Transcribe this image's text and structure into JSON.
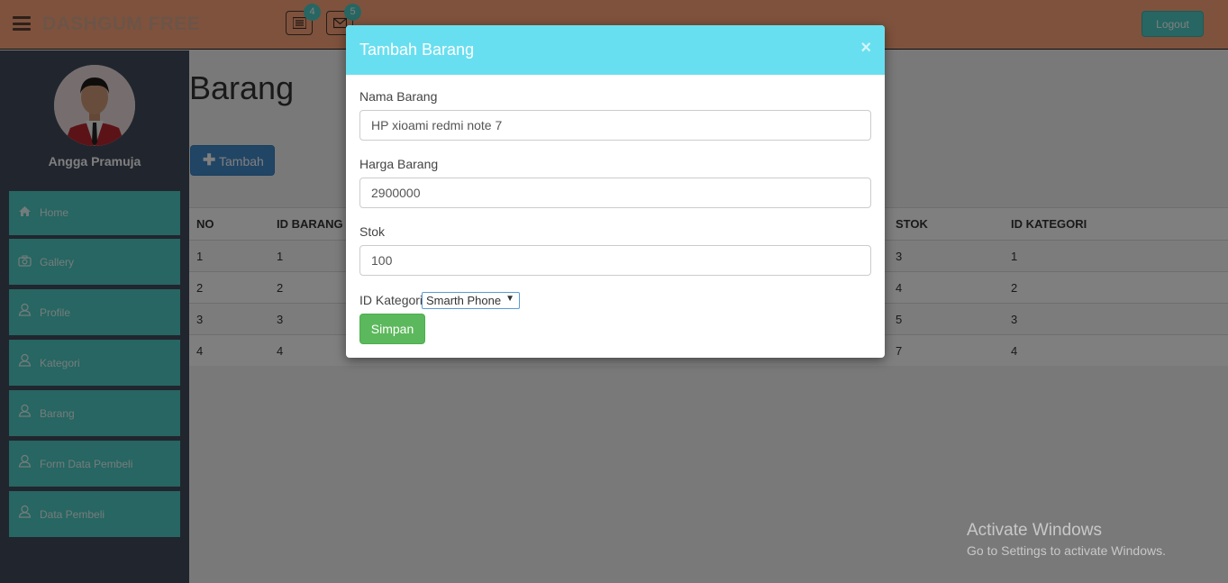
{
  "header": {
    "brand": "DASHGUM FREE",
    "notifications": [
      {
        "icon": "tasks-icon",
        "count": "4"
      },
      {
        "icon": "envelope-icon",
        "count": "5"
      }
    ],
    "logout_label": "Logout"
  },
  "sidebar": {
    "user_name": "Angga Pramuja",
    "items": [
      {
        "label": "Home",
        "icon": "home-icon"
      },
      {
        "label": "Gallery",
        "icon": "camera-icon"
      },
      {
        "label": "Profile",
        "icon": "user-icon"
      },
      {
        "label": "Kategori",
        "icon": "user-icon"
      },
      {
        "label": "Barang",
        "icon": "user-icon"
      },
      {
        "label": "Form Data Pembeli",
        "icon": "user-icon"
      },
      {
        "label": "Data Pembeli",
        "icon": "user-icon"
      }
    ]
  },
  "main": {
    "title": "Barang",
    "add_label": "Tambah",
    "table": {
      "headers": {
        "no": "NO",
        "id": "ID BARANG",
        "stok": "STOK",
        "kategori": "ID KATEGORI"
      },
      "rows": [
        {
          "no": "1",
          "id": "1",
          "stok": "3",
          "kategori": "1"
        },
        {
          "no": "2",
          "id": "2",
          "stok": "4",
          "kategori": "2"
        },
        {
          "no": "3",
          "id": "3",
          "stok": "5",
          "kategori": "3"
        },
        {
          "no": "4",
          "id": "4",
          "stok": "7",
          "kategori": "4"
        }
      ]
    }
  },
  "modal": {
    "title": "Tambah Barang",
    "close": "×",
    "fields": {
      "nama": {
        "label": "Nama Barang",
        "value": "HP xioami redmi note 7"
      },
      "harga": {
        "label": "Harga Barang",
        "value": "2900000"
      },
      "stok": {
        "label": "Stok",
        "value": "100"
      },
      "kategori": {
        "label": "ID Kategori",
        "value": "Smarth Phone"
      }
    },
    "submit_label": "Simpan"
  },
  "watermark": {
    "line1": "Activate Windows",
    "line2": "Go to Settings to activate Windows."
  },
  "colors": {
    "header": "#ffa57a",
    "sidebar": "#424a5d",
    "nav_item": "#4ecdc4",
    "modal_header": "#68dff0",
    "primary": "#428bca",
    "success": "#5cb85c"
  }
}
